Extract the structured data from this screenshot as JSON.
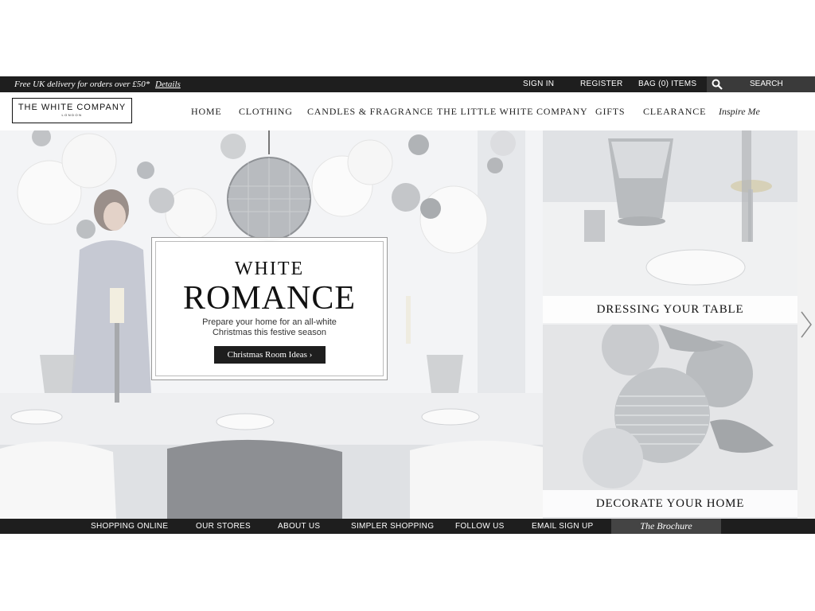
{
  "topbar": {
    "promo": "Free UK delivery for orders over £50*",
    "details": "Details",
    "sign_in": "SIGN IN",
    "register": "REGISTER",
    "bag": "BAG (0) ITEMS",
    "search": "SEARCH",
    "search_icon": "search-icon"
  },
  "logo": {
    "name": "THE WHITE COMPANY",
    "city": "LONDON"
  },
  "nav": {
    "home": "HOME",
    "clothing": "CLOTHING",
    "candles": "CANDLES & FRAGRANCE",
    "little": "THE LITTLE WHITE COMPANY",
    "gifts": "GIFTS",
    "clearance": "CLEARANCE",
    "inspire": "Inspire Me"
  },
  "hero": {
    "title_1": "WHITE",
    "title_2": "ROMANCE",
    "subtitle_1": "Prepare your home for an all-white",
    "subtitle_2": "Christmas this festive season",
    "cta": "Christmas Room Ideas ›"
  },
  "panels": {
    "table": "DRESSING YOUR TABLE",
    "home": "DECORATE YOUR HOME",
    "next_icon": "chevron-right-icon"
  },
  "footer": {
    "shopping": "SHOPPING ONLINE",
    "stores": "OUR STORES",
    "about": "ABOUT US",
    "simpler": "SIMPLER SHOPPING",
    "follow": "FOLLOW US",
    "email": "EMAIL SIGN UP",
    "brochure": "The Brochure"
  }
}
